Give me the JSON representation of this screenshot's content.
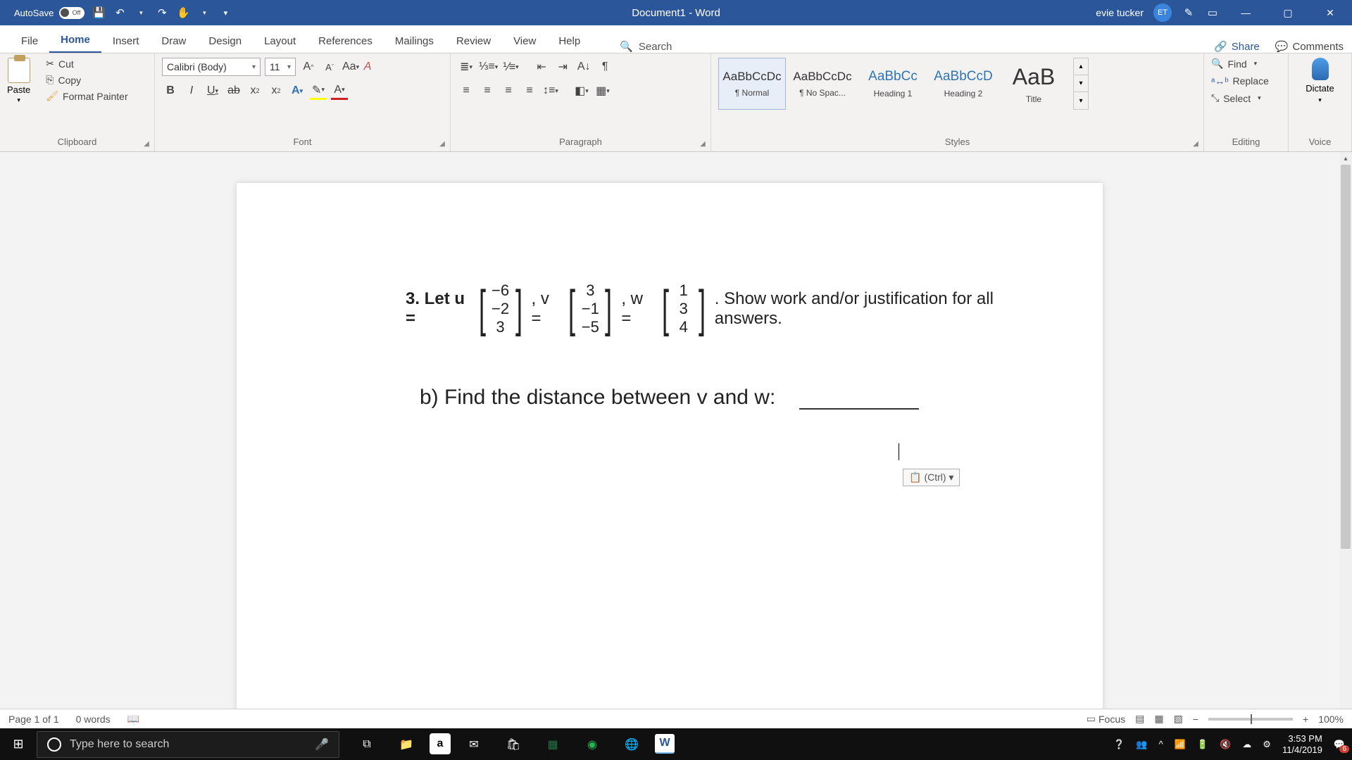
{
  "title": {
    "autosave": "AutoSave",
    "autosave_state": "Off",
    "doc": "Document1 - Word",
    "user": "evie tucker",
    "initials": "ET"
  },
  "tabs": {
    "file": "File",
    "home": "Home",
    "insert": "Insert",
    "draw": "Draw",
    "design": "Design",
    "layout": "Layout",
    "references": "References",
    "mailings": "Mailings",
    "review": "Review",
    "view": "View",
    "help": "Help",
    "search": "Search",
    "share": "Share",
    "comments": "Comments"
  },
  "clipboard": {
    "paste": "Paste",
    "cut": "Cut",
    "copy": "Copy",
    "painter": "Format Painter",
    "label": "Clipboard"
  },
  "font": {
    "name": "Calibri (Body)",
    "size": "11",
    "aa": "Aa",
    "label": "Font"
  },
  "paragraph": {
    "label": "Paragraph"
  },
  "styles": {
    "items": [
      {
        "preview": "AaBbCcDc",
        "name": "¶ Normal"
      },
      {
        "preview": "AaBbCcDc",
        "name": "¶ No Spac..."
      },
      {
        "preview": "AaBbCc",
        "name": "Heading 1"
      },
      {
        "preview": "AaBbCcD",
        "name": "Heading 2"
      },
      {
        "preview": "AaB",
        "name": "Title"
      }
    ],
    "label": "Styles"
  },
  "editing": {
    "find": "Find",
    "replace": "Replace",
    "select": "Select",
    "label": "Editing"
  },
  "voice": {
    "dictate": "Dictate",
    "label": "Voice"
  },
  "doc": {
    "problem_lead": "3. Let u =",
    "v_eq": ", v =",
    "w_eq": ", w =",
    "tail": ". Show work and/or justification for all answers.",
    "u": [
      "−6",
      "−2",
      "3"
    ],
    "v": [
      "3",
      "−1",
      "−5"
    ],
    "w": [
      "1",
      "3",
      "4"
    ],
    "part_b": "b) Find the distance between v and w:",
    "smarttag": "(Ctrl) ▾"
  },
  "status": {
    "page": "Page 1 of 1",
    "words": "0 words",
    "focus": "Focus",
    "zoom": "100%"
  },
  "taskbar": {
    "search_placeholder": "Type here to search",
    "time": "3:53 PM",
    "date": "11/4/2019",
    "notif": "6"
  }
}
